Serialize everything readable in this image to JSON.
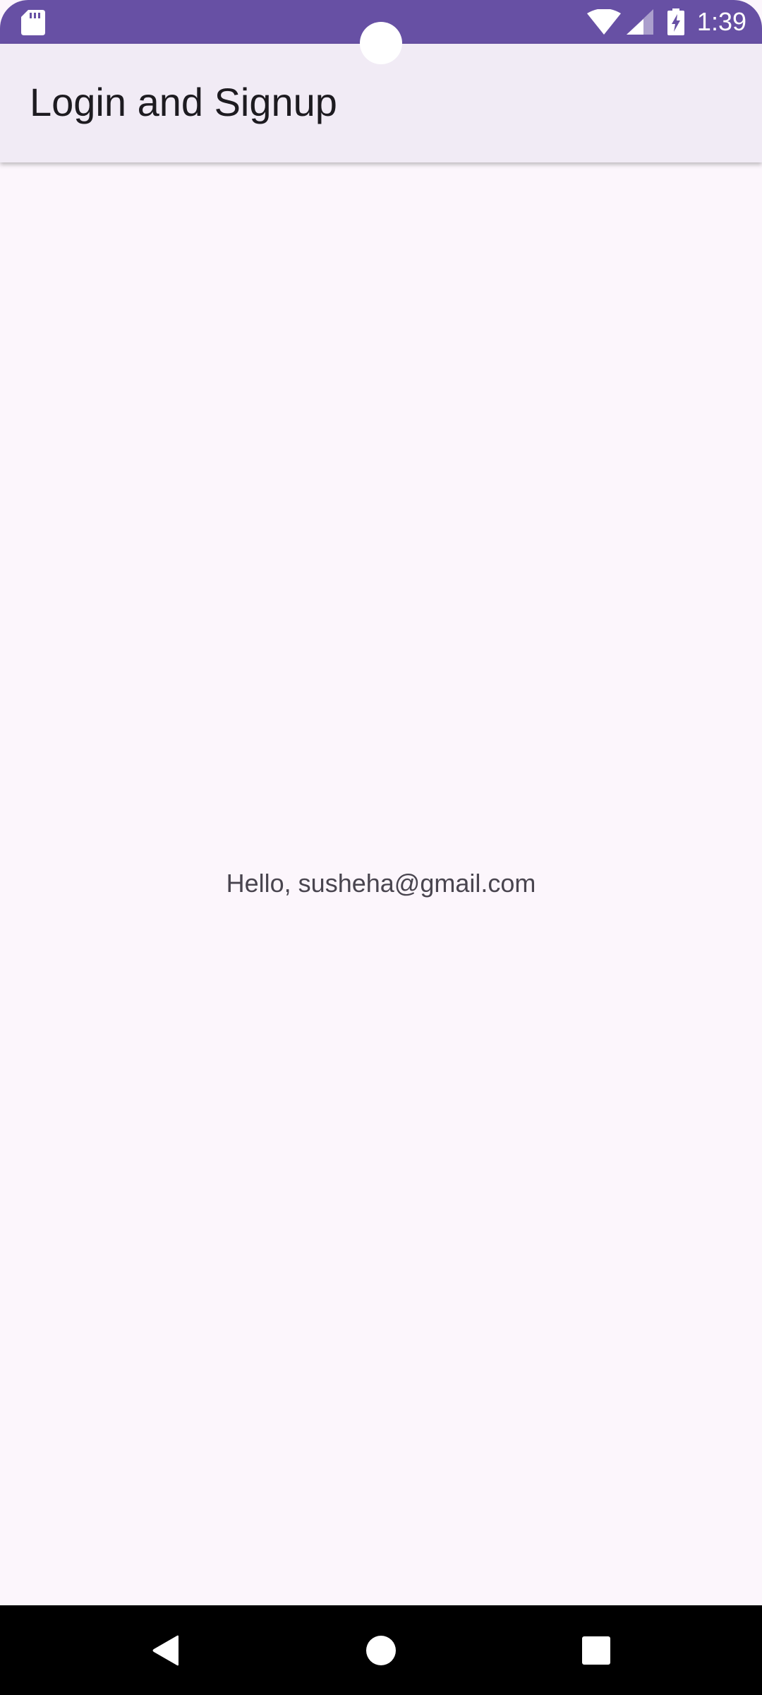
{
  "status_bar": {
    "time": "1:39",
    "background_color": "#6750a4",
    "icons": [
      "sd-card-icon",
      "wifi-icon",
      "cell-signal-icon",
      "battery-charging-icon"
    ]
  },
  "app_bar": {
    "title": "Login and Signup",
    "background_color": "#f1ebf5"
  },
  "content": {
    "greeting": "Hello, susheha@gmail.com",
    "background_color": "#fcf6fc"
  },
  "nav_bar": {
    "icons": [
      "back-icon",
      "home-icon",
      "recents-icon"
    ]
  }
}
